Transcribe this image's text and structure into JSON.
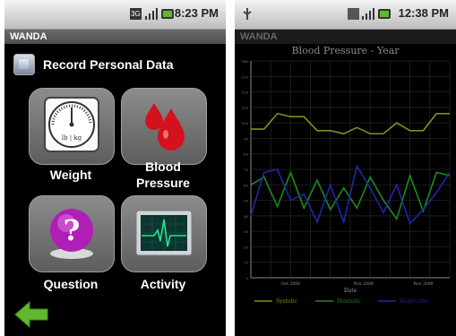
{
  "left_screen": {
    "status_bar": {
      "time": "8:23 PM",
      "network_badge": "3G"
    },
    "app_title": "WANDA",
    "header": {
      "title": "Record Personal Data",
      "icon": "database-icon"
    },
    "tiles": [
      {
        "id": "weight",
        "label": "Weight",
        "icon": "scale-icon",
        "scale_text": "lb | kg"
      },
      {
        "id": "blood-pressure",
        "label_line1": "Blood",
        "label_line2": "Pressure",
        "icon": "blood-drop-icon"
      },
      {
        "id": "question",
        "label": "Question",
        "icon": "question-icon"
      },
      {
        "id": "activity",
        "label": "Activity",
        "icon": "heart-monitor-icon"
      }
    ],
    "back_icon": "back-arrow-icon",
    "colors": {
      "tile": "#7a7a7a",
      "arrow": "#5fb82f",
      "blood": "#d4121e",
      "question": "#b01fb5",
      "monitor": "#2ee08c"
    }
  },
  "right_screen": {
    "status_bar": {
      "time": "12:38 PM"
    },
    "app_title": "WANDA",
    "chart_data": {
      "type": "line",
      "title": "Blood Pressure - Year",
      "xlabel": "Date",
      "ylabel": "",
      "ylim": [
        0,
        140
      ],
      "x_ticks": [
        "Oct 2008",
        "Nov 2008",
        "Nov 2008"
      ],
      "y_ticks": [
        "0",
        "10",
        "20",
        "30",
        "40",
        "50",
        "60",
        "70",
        "80",
        "90",
        "100",
        "110",
        "120",
        "130",
        "140"
      ],
      "x": [
        0,
        1,
        2,
        3,
        4,
        5,
        6,
        7,
        8,
        9,
        10,
        11,
        12,
        13,
        14,
        15
      ],
      "series": [
        {
          "name": "Systolic",
          "color": "#8a8a1f",
          "values": [
            96,
            96,
            106,
            104,
            104,
            95,
            95,
            93,
            97,
            93,
            93,
            100,
            95,
            95,
            106,
            106
          ]
        },
        {
          "name": "Diastolic",
          "color": "#1e8a1e",
          "values": [
            60,
            65,
            46,
            68,
            45,
            63,
            44,
            58,
            45,
            65,
            50,
            38,
            66,
            43,
            68,
            66
          ]
        },
        {
          "name": "Heart rate",
          "color": "#1f28a5",
          "values": [
            40,
            68,
            70,
            50,
            54,
            36,
            60,
            36,
            72,
            58,
            42,
            60,
            35,
            44,
            55,
            68
          ]
        }
      ],
      "legend": "bottom",
      "grid": true
    }
  }
}
